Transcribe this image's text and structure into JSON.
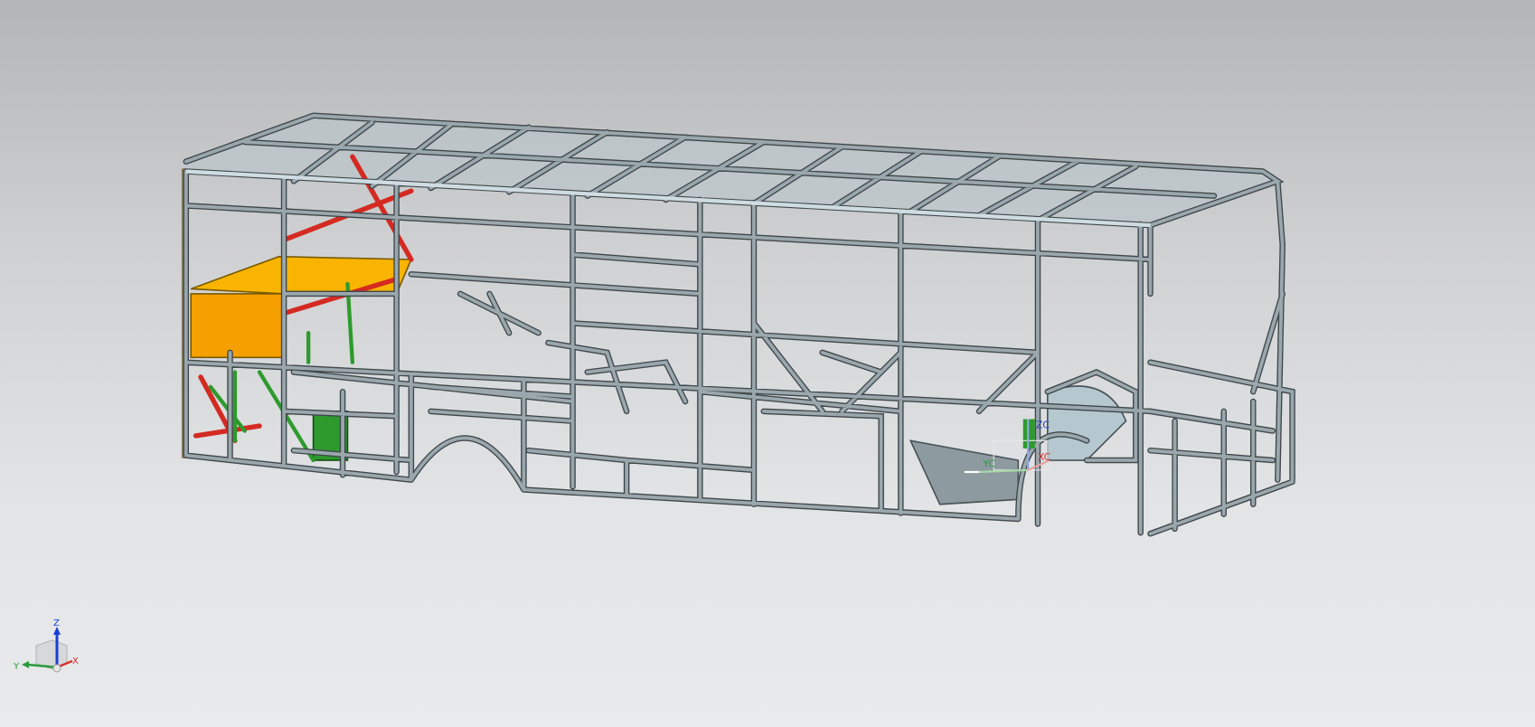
{
  "viewport": {
    "background_top": "#b4b5b7",
    "background_bottom": "#e8eaeb",
    "model": "bus-body-frame",
    "frame_color": "#9aa7ac",
    "highlight_colors": {
      "orange": "#f5a800",
      "green": "#2e9a2e",
      "red": "#d42a22"
    }
  },
  "wcs": {
    "z_label": "ZC",
    "y_label": "YC",
    "x_label": "XC"
  },
  "view_triad": {
    "z_label": "Z",
    "y_label": "Y",
    "x_label": "X",
    "colors": {
      "z": "#1a3fd6",
      "y": "#2a9a3a",
      "x": "#d63030"
    }
  }
}
